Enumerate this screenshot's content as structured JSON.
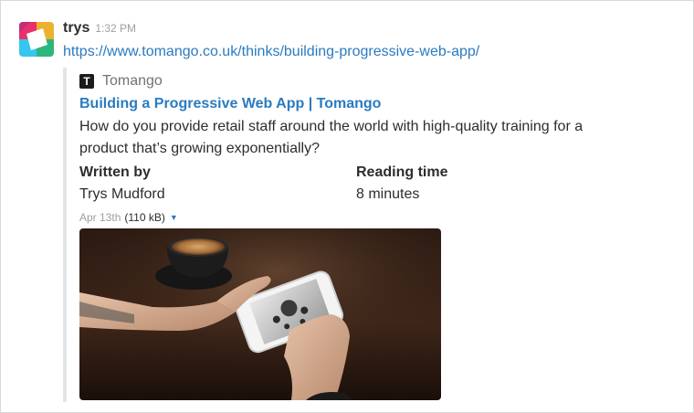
{
  "message": {
    "sender": "trys",
    "time": "1:32 PM",
    "link": "https://www.tomango.co.uk/thinks/building-progressive-web-app/"
  },
  "attachment": {
    "provider_icon_letter": "T",
    "provider_name": "Tomango",
    "title": "Building a Progressive Web App | Tomango",
    "text": "How do you provide retail staff around the world with high-quality training for a product that’s growing exponentially?",
    "fields": [
      {
        "title": "Written by",
        "value": "Trys Mudford"
      },
      {
        "title": "Reading time",
        "value": "8 minutes"
      }
    ],
    "date": "Apr 13th",
    "size": "(110 kB)"
  },
  "icons": {
    "avatar": "slack-logo-avatar",
    "caret": "caret-down-icon"
  },
  "colors": {
    "link": "#2a7bbf",
    "muted": "#9e9ea6",
    "text": "#2c2d30",
    "attachment_border": "#e3e4e6"
  }
}
